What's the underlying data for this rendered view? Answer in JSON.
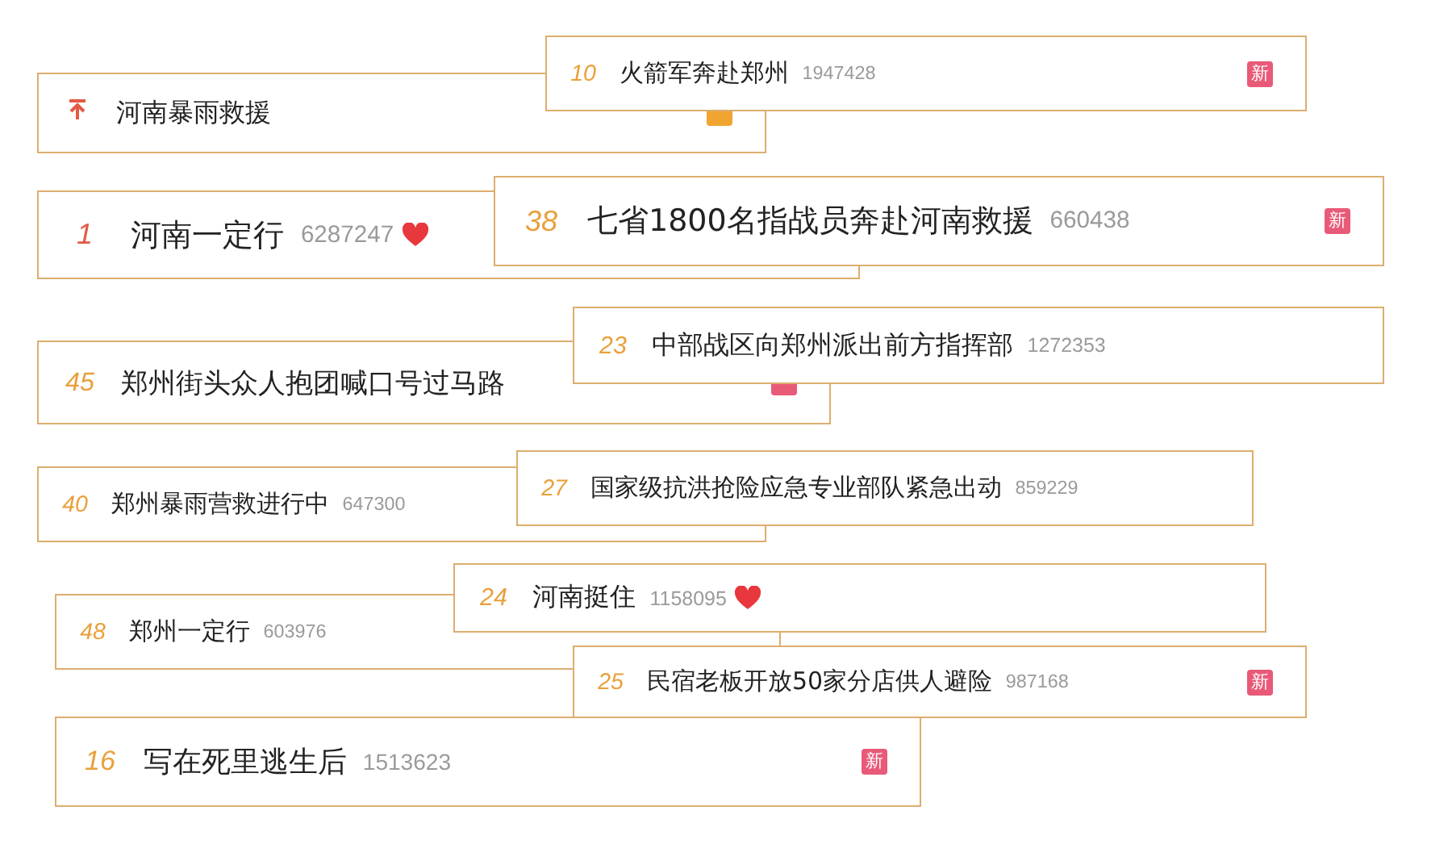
{
  "cards": [
    {
      "kind": "pinned",
      "title": "河南暴雨救援",
      "hearted": false,
      "badge": {
        "kind": "hot"
      }
    },
    {
      "kind": "normal",
      "rank": "10",
      "title": "火箭军奔赴郑州",
      "count": "1947428",
      "hearted": false,
      "badge": {
        "kind": "new",
        "text": "新"
      }
    },
    {
      "kind": "top",
      "rank": "1",
      "title": "河南一定行",
      "count": "6287247",
      "hearted": true
    },
    {
      "kind": "normal",
      "rank": "38",
      "title": "七省1800名指战员奔赴河南救援",
      "count": "660438",
      "hearted": false,
      "badge": {
        "kind": "new",
        "text": "新"
      }
    },
    {
      "kind": "normal",
      "rank": "45",
      "title": "郑州街头众人抱团喊口号过马路",
      "hearted": false,
      "badge": {
        "kind": "new"
      }
    },
    {
      "kind": "normal",
      "rank": "23",
      "title": "中部战区向郑州派出前方指挥部",
      "count": "1272353",
      "hearted": false
    },
    {
      "kind": "normal",
      "rank": "40",
      "title": "郑州暴雨营救进行中",
      "count": "647300",
      "hearted": false
    },
    {
      "kind": "normal",
      "rank": "27",
      "title": "国家级抗洪抢险应急专业部队紧急出动",
      "count": "859229",
      "hearted": false
    },
    {
      "kind": "normal",
      "rank": "48",
      "title": "郑州一定行",
      "count": "603976",
      "hearted": false
    },
    {
      "kind": "normal",
      "rank": "24",
      "title": "河南挺住",
      "count": "1158095",
      "hearted": true
    },
    {
      "kind": "normal",
      "rank": "25",
      "title": "民宿老板开放50家分店供人避险",
      "count": "987168",
      "hearted": false,
      "badge": {
        "kind": "new",
        "text": "新"
      }
    },
    {
      "kind": "normal",
      "rank": "16",
      "title": "写在死里逃生后",
      "count": "1513623",
      "hearted": false,
      "badge": {
        "kind": "new",
        "text": "新"
      }
    }
  ]
}
